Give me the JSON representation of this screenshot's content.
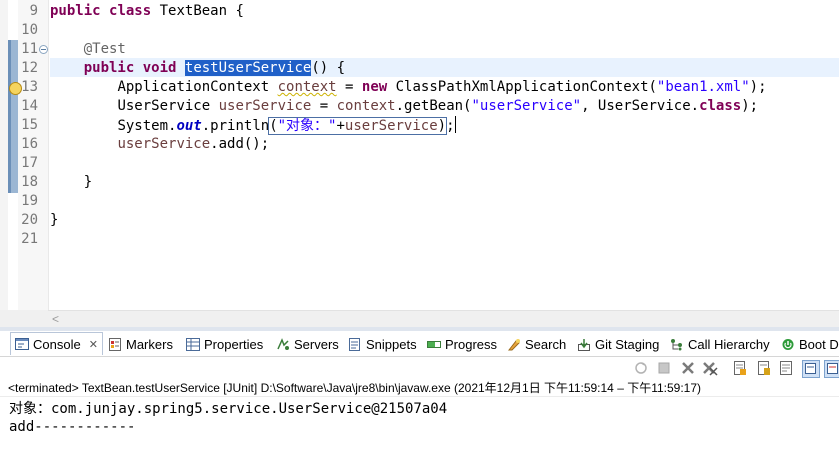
{
  "editor": {
    "line_numbers": [
      "9",
      "10",
      "11",
      "12",
      "13",
      "14",
      "15",
      "16",
      "17",
      "18",
      "19",
      "20",
      "21"
    ],
    "l9_kw1": "public",
    "l9_kw2": "class",
    "l9_rest": " TextBean {",
    "l11_ann": "@Test",
    "l12_kw1": "public",
    "l12_kw2": "void",
    "l12_method": "testUserService",
    "l12_rest": "() {",
    "l13_type": "ApplicationContext ",
    "l13_var": "context",
    "l13_eq": " = ",
    "l13_new": "new",
    "l13_ctor": " ClassPathXmlApplicationContext(",
    "l13_str": "\"bean1.xml\"",
    "l13_end": ");",
    "l14_type": "UserService ",
    "l14_var": "userService",
    "l14_eq": " = ",
    "l14_ctx": "context",
    "l14_call": ".getBean(",
    "l14_str": "\"userService\"",
    "l14_mid": ", UserService.",
    "l14_kw": "class",
    "l14_end": ");",
    "l15_sys": "System.",
    "l15_out": "out",
    "l15_call": ".println",
    "l15_open": "(",
    "l15_str": "\"对象：\"",
    "l15_plus": "+",
    "l15_var": "userService",
    "l15_close": ")",
    "l15_end": ";",
    "l16_var": "userService",
    "l16_rest": ".add();",
    "l18_brace": "}",
    "l20_brace": "}"
  },
  "views": {
    "tabs": [
      {
        "label": "Console",
        "icon": "console-icon"
      },
      {
        "label": "Markers",
        "icon": "markers-icon"
      },
      {
        "label": "Properties",
        "icon": "properties-icon"
      },
      {
        "label": "Servers",
        "icon": "servers-icon"
      },
      {
        "label": "Snippets",
        "icon": "snippets-icon"
      },
      {
        "label": "Progress",
        "icon": "progress-icon"
      },
      {
        "label": "Search",
        "icon": "search-icon"
      },
      {
        "label": "Git Staging",
        "icon": "git-staging-icon"
      },
      {
        "label": "Call Hierarchy",
        "icon": "call-hierarchy-icon"
      },
      {
        "label": "Boot D",
        "icon": "boot-dashboard-icon"
      }
    ],
    "close_glyph": "✕"
  },
  "console": {
    "header": "<terminated> TextBean.testUserService [JUnit] D:\\Software\\Java\\jre8\\bin\\javaw.exe  (2021年12月1日 下午11:59:14 – 下午11:59:17)",
    "output": [
      "对象：com.junjay.spring5.service.UserService@21507a04",
      "add------------"
    ]
  },
  "colors": {
    "keyword": "#7f0055",
    "string": "#2a00ff",
    "field": "#0000c0",
    "annotation": "#646464",
    "selection": "#2060c8"
  }
}
